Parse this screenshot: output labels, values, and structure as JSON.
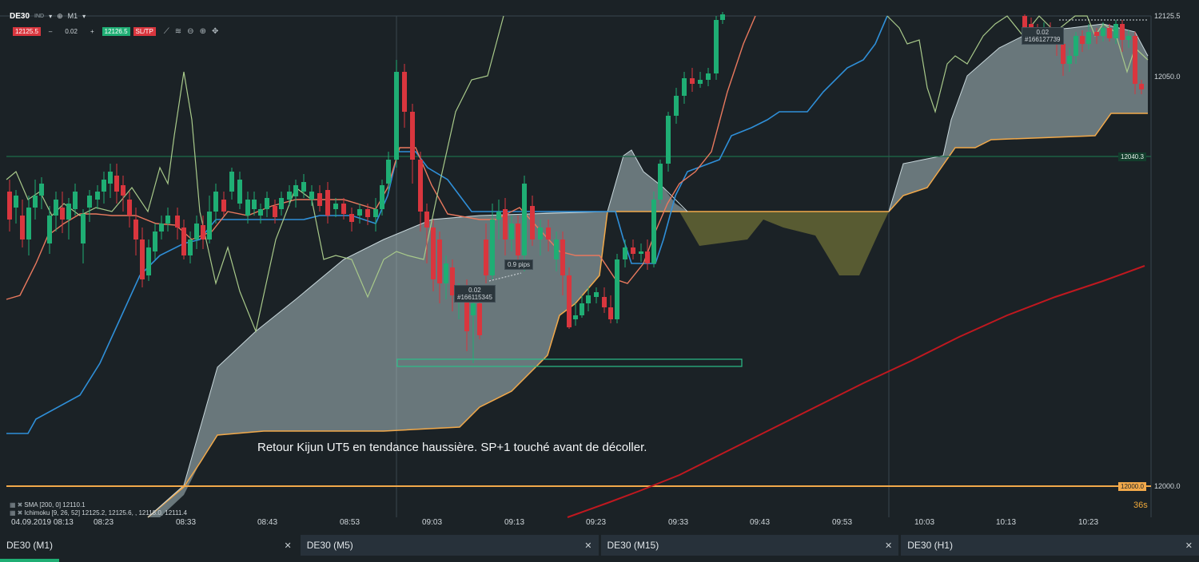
{
  "toolbar": {
    "symbol": "DE30",
    "index_tag": "IND",
    "timeframe": "M1",
    "bid": "12125.5",
    "qty_minus": "–",
    "qty": "0.02",
    "qty_plus": "+",
    "ask": "12126.5",
    "sltp": "SL/TP"
  },
  "price_axis": {
    "labels": [
      "12125.5",
      "12050.0",
      "12000.0"
    ],
    "line_badge": "12040.3",
    "level_badge": "12000.0"
  },
  "time_axis": {
    "first": "04.09.2019 08:13",
    "labels": [
      "08:23",
      "08:33",
      "08:43",
      "08:53",
      "09:03",
      "09:13",
      "09:23",
      "09:33",
      "09:43",
      "09:53",
      "10:03",
      "10:13",
      "10:23"
    ]
  },
  "legend": {
    "sma": "SMA [200, 0] 12110.1",
    "ichimoku": "Ichimoku [9, 26, 52] 12125.2, 12125.6, , 12118.0, 12111.4"
  },
  "trades": {
    "trade1_qty": "0.02",
    "trade1_id": "#166115345",
    "pips": "0.9 pips",
    "trade2_qty": "0.02",
    "trade2_id": "#166127739"
  },
  "annotation": "Retour Kijun UT5 en tendance haussière. SP+1 touché avant de décoller.",
  "countdown": "36s",
  "tabs": [
    {
      "label": "DE30 (M1)"
    },
    {
      "label": "DE30 (M5)"
    },
    {
      "label": "DE30 (M15)"
    },
    {
      "label": "DE30 (H1)"
    }
  ],
  "colors": {
    "background": "#1b2226",
    "bull": "#1fae74",
    "bear": "#d9363e",
    "kijun": "#2f8fd8",
    "tenkan": "#e9795e",
    "chikou": "#a8c98a",
    "span_b": "#f2a94a",
    "sma": "#c0181f"
  }
}
